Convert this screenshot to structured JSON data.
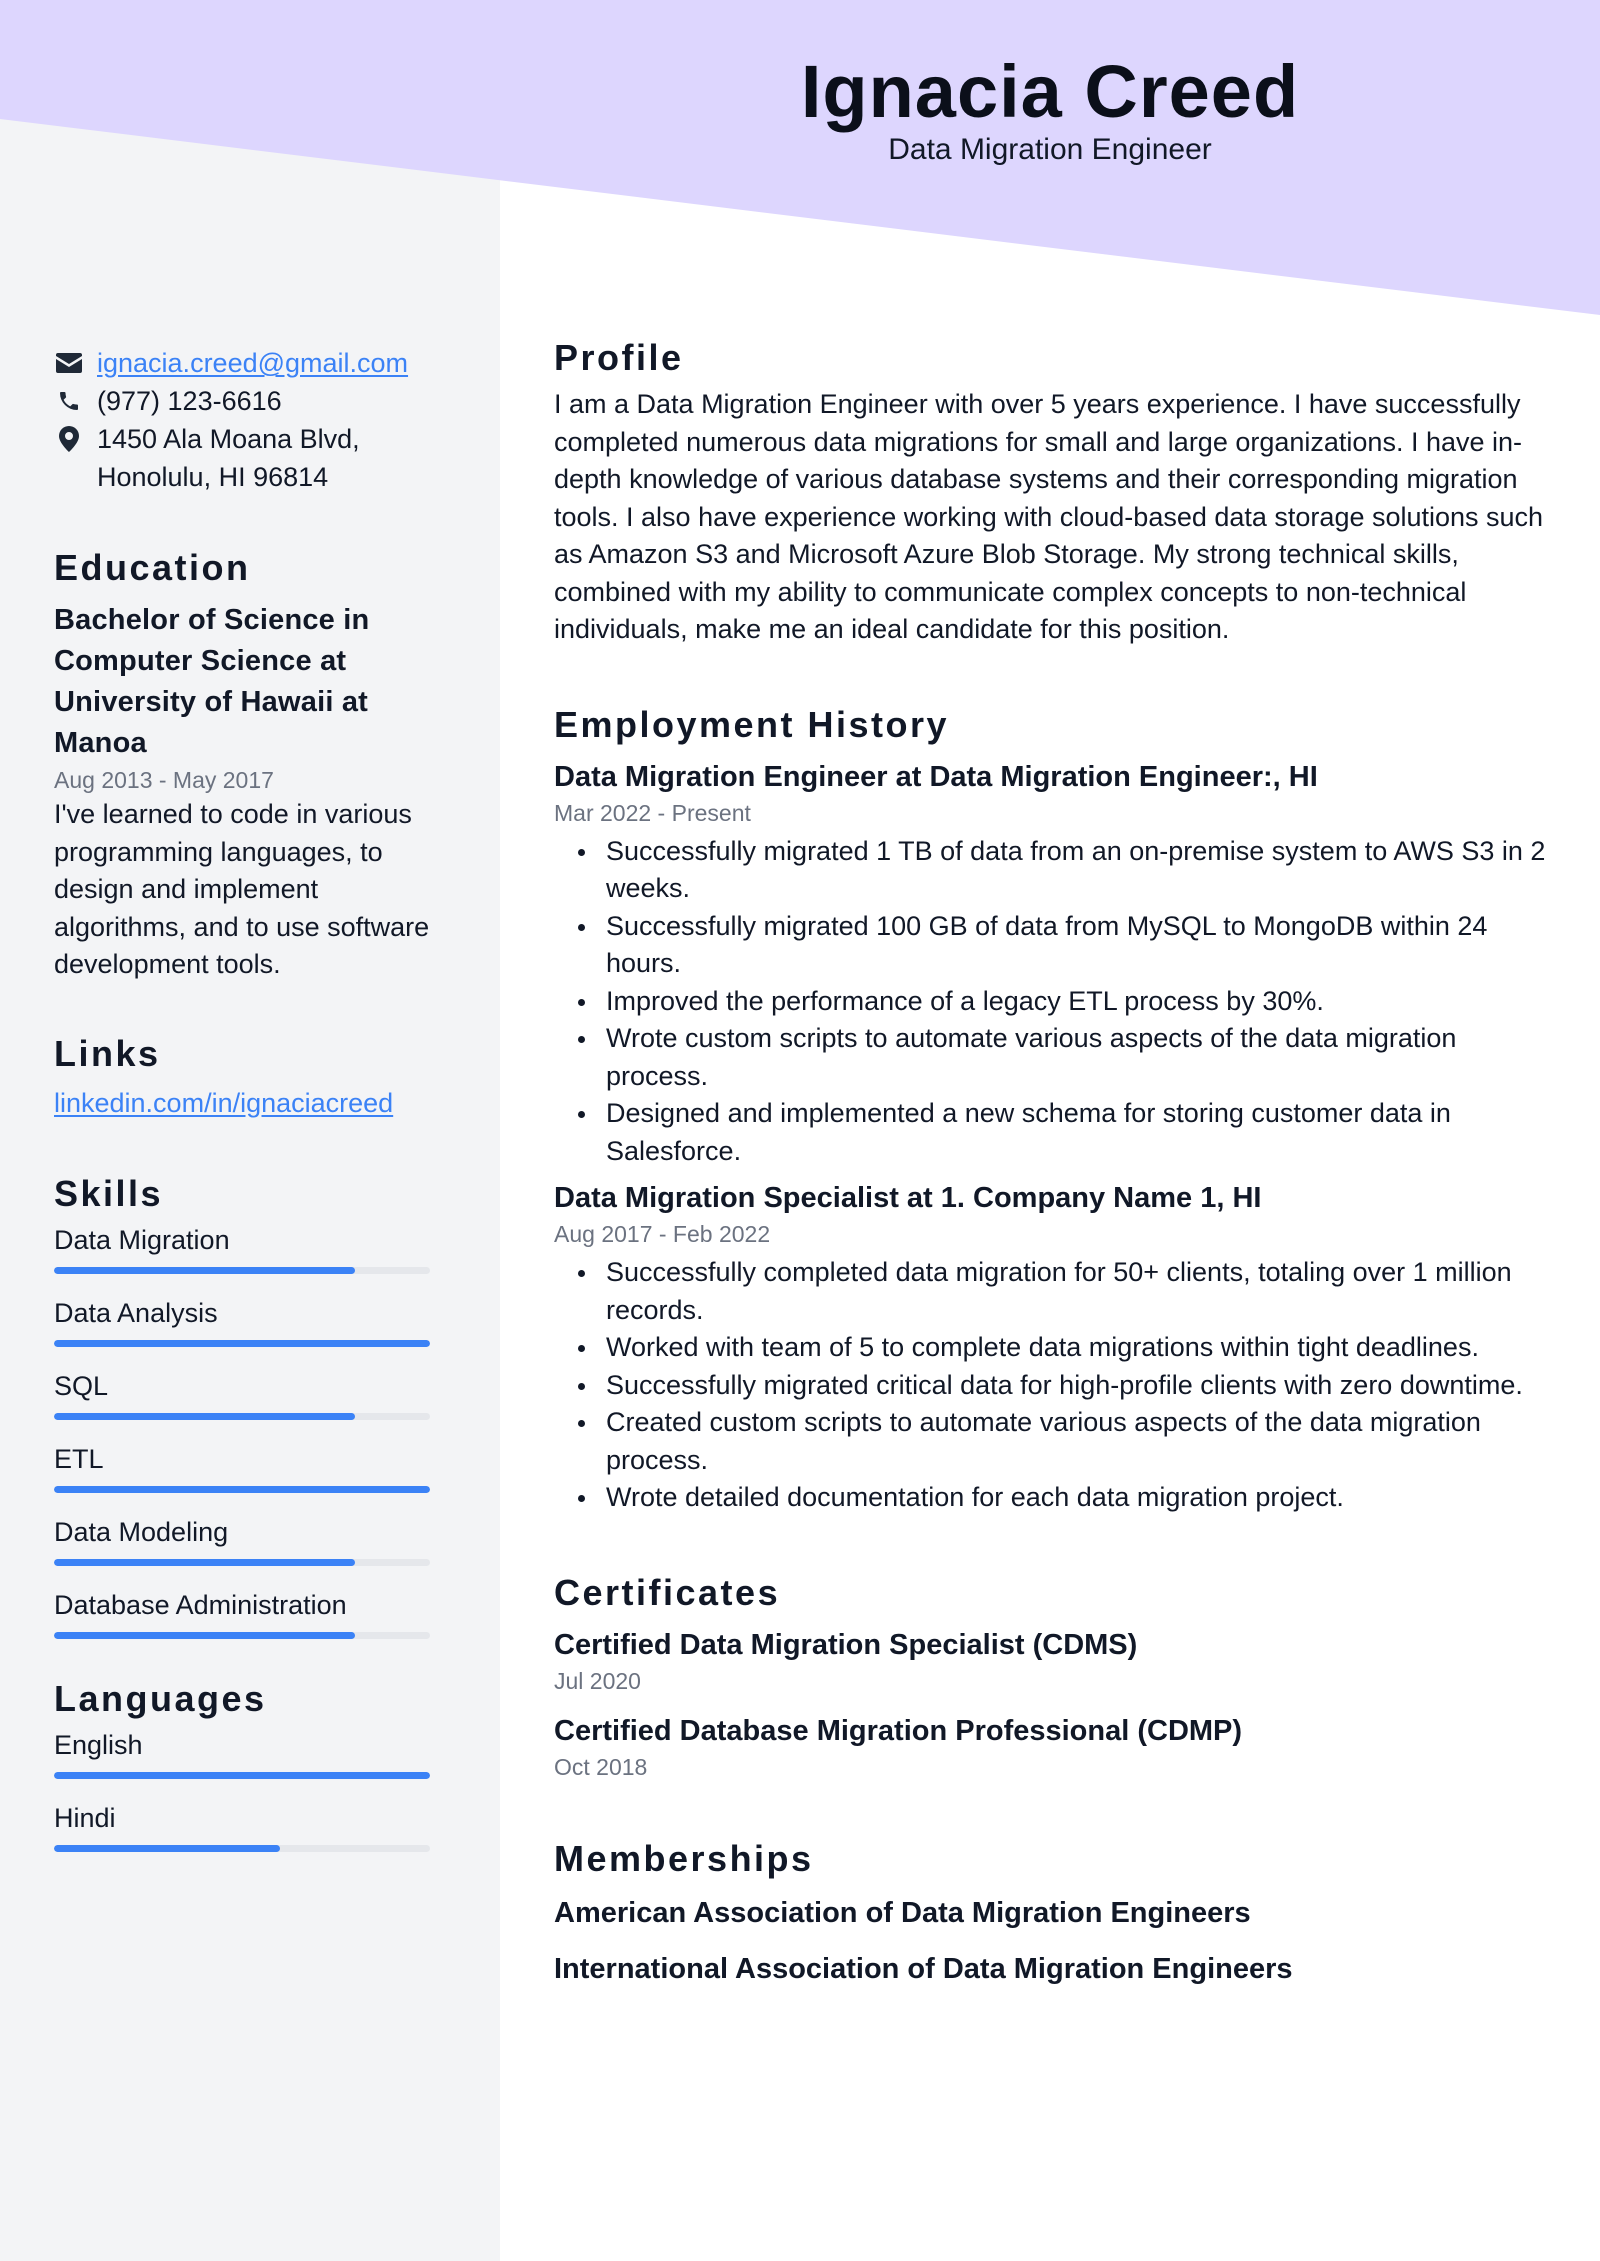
{
  "colors": {
    "header_band": "#ddd6fe",
    "sidebar": "#f3f4f6",
    "accent": "#3b82f6",
    "bar_track": "#e5e7eb"
  },
  "header": {
    "name": "Ignacia Creed",
    "title": "Data Migration Engineer"
  },
  "contact": {
    "email": {
      "icon": "envelope-icon",
      "value": "ignacia.creed@gmail.com"
    },
    "phone": {
      "icon": "phone-icon",
      "value": "(977) 123-6616"
    },
    "address": {
      "icon": "map-pin-icon",
      "line1": "1450 Ala Moana Blvd,",
      "line2": "Honolulu, HI 96814"
    }
  },
  "education": {
    "heading": "Education",
    "degree": "Bachelor of Science in Computer Science at University of Hawaii at Manoa",
    "dates": "Aug 2013 - May 2017",
    "description": "I've learned to code in various programming languages, to design and implement algorithms, and to use software development tools."
  },
  "links": {
    "heading": "Links",
    "items": [
      {
        "label": "linkedin.com/in/ignaciacreed"
      }
    ]
  },
  "skills": {
    "heading": "Skills",
    "items": [
      {
        "label": "Data Migration",
        "level": 0.8
      },
      {
        "label": "Data Analysis",
        "level": 1.0
      },
      {
        "label": "SQL",
        "level": 0.8
      },
      {
        "label": "ETL",
        "level": 1.0
      },
      {
        "label": "Data Modeling",
        "level": 0.8
      },
      {
        "label": "Database Administration",
        "level": 0.8
      }
    ]
  },
  "languages": {
    "heading": "Languages",
    "items": [
      {
        "label": "English",
        "level": 1.0
      },
      {
        "label": "Hindi",
        "level": 0.6
      }
    ]
  },
  "profile": {
    "heading": "Profile",
    "text": "I am a Data Migration Engineer with over 5 years experience. I have successfully completed numerous data migrations for small and large organizations. I have in-depth knowledge of various database systems and their corresponding migration tools. I also have experience working with cloud-based data storage solutions such as Amazon S3 and Microsoft Azure Blob Storage. My strong technical skills, combined with my ability to communicate complex concepts to non-technical individuals, make me an ideal candidate for this position."
  },
  "employment": {
    "heading": "Employment History",
    "jobs": [
      {
        "title": "Data Migration Engineer at Data Migration Engineer:, HI",
        "dates": "Mar 2022 - Present",
        "bullets": [
          "Successfully migrated 1 TB of data from an on-premise system to AWS S3 in 2 weeks.",
          "Successfully migrated 100 GB of data from MySQL to MongoDB within 24 hours.",
          "Improved the performance of a legacy ETL process by 30%.",
          "Wrote custom scripts to automate various aspects of the data migration process.",
          "Designed and implemented a new schema for storing customer data in Salesforce."
        ]
      },
      {
        "title": "Data Migration Specialist at 1. Company Name 1, HI",
        "dates": "Aug 2017 - Feb 2022",
        "bullets": [
          "Successfully completed data migration for 50+ clients, totaling over 1 million records.",
          "Worked with team of 5 to complete data migrations within tight deadlines.",
          "Successfully migrated critical data for high-profile clients with zero downtime.",
          "Created custom scripts to automate various aspects of the data migration process.",
          "Wrote detailed documentation for each data migration project."
        ]
      }
    ]
  },
  "certificates": {
    "heading": "Certificates",
    "items": [
      {
        "name": "Certified Data Migration Specialist (CDMS)",
        "date": "Jul 2020"
      },
      {
        "name": "Certified Database Migration Professional (CDMP)",
        "date": "Oct 2018"
      }
    ]
  },
  "memberships": {
    "heading": "Memberships",
    "items": [
      "American Association of Data Migration Engineers",
      "International Association of Data Migration Engineers"
    ]
  }
}
